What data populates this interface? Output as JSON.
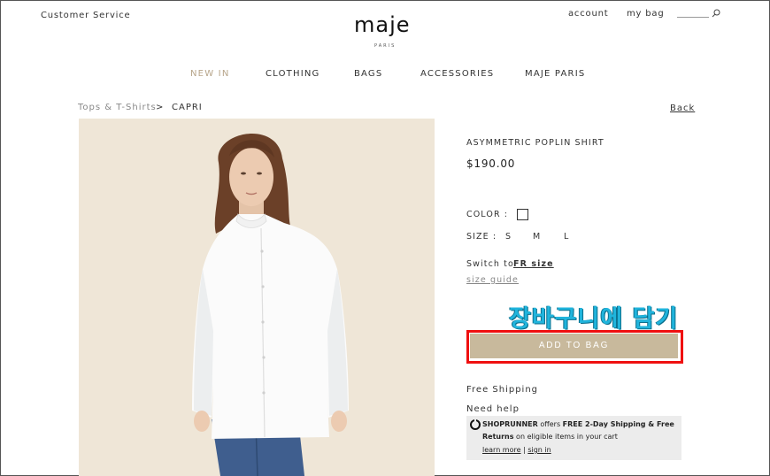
{
  "header": {
    "customer_service": "Customer Service",
    "logo": "maje",
    "logo_sub": "PARIS",
    "account": "account",
    "my_bag": "my bag",
    "search_icon": "search-icon"
  },
  "nav": {
    "items": [
      {
        "label": "NEW IN"
      },
      {
        "label": "CLOTHING"
      },
      {
        "label": "BAGS"
      },
      {
        "label": "ACCESSORIES"
      },
      {
        "label": "MAJE PARIS"
      }
    ]
  },
  "breadcrumb": {
    "parent": "Tops & T-Shirts",
    "separator": ">",
    "current": "CAPRI",
    "back": "Back"
  },
  "product": {
    "title": "ASYMMETRIC POPLIN SHIRT",
    "price": "$190.00",
    "color_label": "COLOR :",
    "size_label": "SIZE :",
    "sizes": [
      "S",
      "M",
      "L"
    ],
    "switch_prefix": "Switch to",
    "switch_link": "FR size",
    "size_guide": "size guide",
    "annotation_korean": "장바구니에 담기",
    "add_to_bag": "ADD TO BAG",
    "free_shipping": "Free Shipping",
    "need_help": "Need help"
  },
  "shoprunner": {
    "brand": "SHOPRUNNER",
    "line1_rest": " offers ",
    "line1_bold": "FREE 2-Day Shipping & Free",
    "line2_bold": "Returns",
    "line2_rest": " on eligible items in your cart",
    "learn_more": "learn more",
    "divider": " | ",
    "sign_in": "sign in"
  },
  "colors": {
    "accent_nav": "#b7a58a",
    "button_bg": "#c8b99c",
    "highlight_border": "#ef1010",
    "annotation_text": "#20b4dc"
  }
}
